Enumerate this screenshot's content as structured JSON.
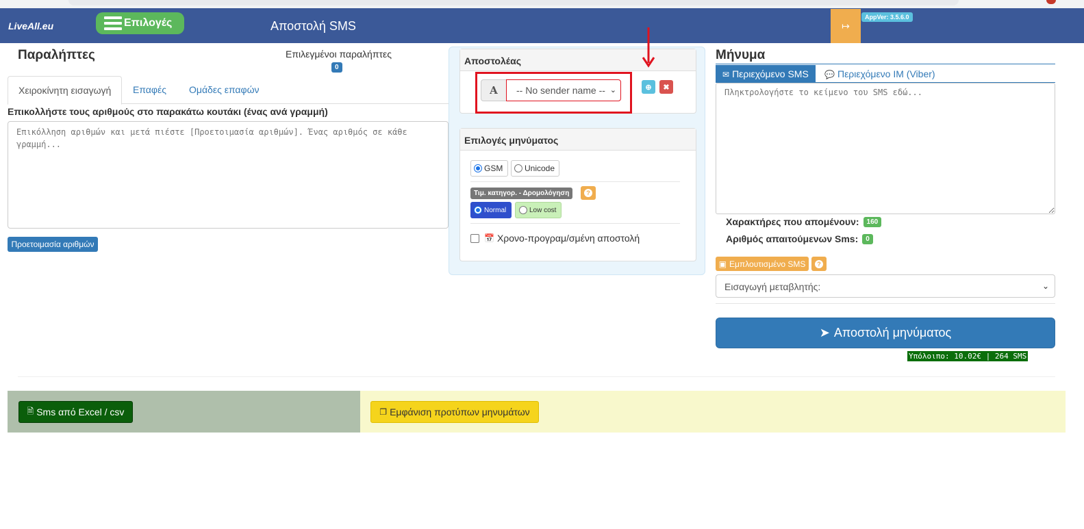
{
  "navbar": {
    "brand": "LiveAll.eu",
    "menu_label": "Επιλογές",
    "page_title": "Αποστολή SMS",
    "app_version": "AppVer: 3.5.6.0"
  },
  "recipients": {
    "title": "Παραλήπτες",
    "selected_label": "Επιλεγμένοι παραλήπτες",
    "selected_count": "0",
    "tabs": [
      "Χειροκίνητη εισαγωγή",
      "Επαφές",
      "Ομάδες επαφών"
    ],
    "paste_label": "Επικολλήστε τους αριθμούς στο παρακάτω κουτάκι (ένας ανά γραμμή)",
    "numbers_placeholder": "Επικόλληση αριθμών και μετά πιέστε [Προετοιμασία αριθμών]. Ένας αριθμός σε κάθε γραμμή...",
    "prepare_button": "Προετοιμασία αριθμών"
  },
  "sender": {
    "title": "Αποστολέας",
    "addon": "A",
    "selected": "-- No sender name --"
  },
  "options": {
    "title": "Επιλογές μηνύματος",
    "encoding": [
      {
        "label": "GSM",
        "checked": true
      },
      {
        "label": "Unicode",
        "checked": false
      }
    ],
    "routing_label": "Τιμ. κατηγορ. - Δρομολόγηση",
    "help": "?",
    "routing": [
      {
        "label": "Normal",
        "checked": true
      },
      {
        "label": "Low cost",
        "checked": false
      }
    ],
    "schedule_label": "Χρονο-προγραμ/σμένη αποστολή"
  },
  "message": {
    "title": "Μήνυμα",
    "tabs": [
      "Περιεχόμενο SMS",
      "Περιεχόμενο IM (Viber)"
    ],
    "placeholder": "Πληκτρολογήστε το κείμενο του SMS εδώ...",
    "chars_left_label": "Χαρακτήρες που απομένουν:",
    "chars_left": "160",
    "sms_count_label": "Αριθμός απαιτούμενων Sms:",
    "sms_count": "0",
    "rich_sms_button": "Εμπλουτισμένο SMS",
    "help": "?",
    "variable_select": "Εισαγωγή μεταβλητής:",
    "send_button": "Αποστολή μηνύματος",
    "balance": "Υπόλοιπο: 10.02€ | 264 SMS"
  },
  "bottom": {
    "excel_button": "Sms από Excel / csv",
    "templates_button": "Εμφάνιση προτύπων μηνυμάτων"
  },
  "colors": {
    "navbar": "#3b5998",
    "primary": "#337ab7",
    "success": "#5cb85c",
    "warning": "#f0ad4e",
    "highlight_red": "#e0131f"
  }
}
